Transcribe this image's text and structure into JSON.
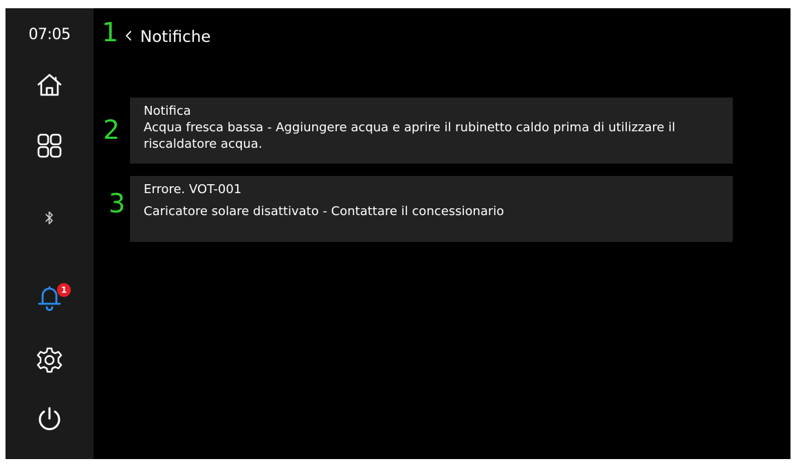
{
  "status": {
    "time": "07:05"
  },
  "sidebar": {
    "nav": [
      {
        "icon": "home-icon"
      },
      {
        "icon": "apps-grid-icon"
      },
      {
        "icon": "bluetooth-icon"
      },
      {
        "icon": "bell-icon",
        "badge": "1"
      },
      {
        "icon": "gear-icon"
      },
      {
        "icon": "power-icon"
      }
    ]
  },
  "header": {
    "back_icon": "chevron-left-icon",
    "title": "Notifiche"
  },
  "annotations": {
    "m1": "1",
    "m2": "2",
    "m3": "3"
  },
  "notifications": [
    {
      "title": "Notifica",
      "body": "Acqua fresca bassa - Aggiungere acqua e aprire il rubinetto caldo prima di utilizzare il riscaldatore acqua."
    },
    {
      "title": "Errore. VOT-001",
      "body": "Caricatore solare disattivato - Contattare il concessionario"
    }
  ],
  "colors": {
    "background": "#000000",
    "sidebar": "#1b1b1b",
    "card": "#222222",
    "accent_blue": "#2a8cf0",
    "badge_red": "#e41e26",
    "annotation_green": "#2fd22f",
    "text": "#ffffff"
  }
}
